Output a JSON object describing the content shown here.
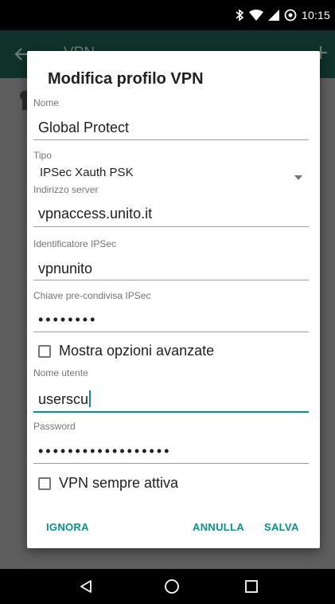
{
  "status_bar": {
    "time": "10:15",
    "icons": [
      "bluetooth-icon",
      "wifi-icon",
      "signal-icon",
      "data-saver-icon"
    ]
  },
  "background_app": {
    "title": "VPN"
  },
  "dialog": {
    "title": "Modifica profilo VPN",
    "fields": {
      "name": {
        "label": "Nome",
        "value": "Global Protect"
      },
      "type": {
        "label": "Tipo",
        "value": "IPSec Xauth PSK"
      },
      "server": {
        "label": "Indirizzo server",
        "value": "vpnaccess.unito.it"
      },
      "ipsec_id": {
        "label": "Identificatore IPSec",
        "value": "vpnunito"
      },
      "psk": {
        "label": "Chiave pre-condivisa IPSec",
        "value": "••••••••"
      },
      "advanced": {
        "label": "Mostra opzioni avanzate",
        "checked": false
      },
      "username": {
        "label": "Nome utente",
        "value": "userscu"
      },
      "password": {
        "label": "Password",
        "value": "••••••••••••••••••"
      },
      "always_on": {
        "label": "VPN sempre attiva",
        "checked": false
      }
    },
    "actions": {
      "ignore": "IGNORA",
      "cancel": "ANNULLA",
      "save": "SALVA"
    }
  },
  "colors": {
    "accent": "#009688",
    "status_bar": "#000000",
    "app_bar_dimmed": "#10322b",
    "scrim": "#5e5e5e"
  }
}
